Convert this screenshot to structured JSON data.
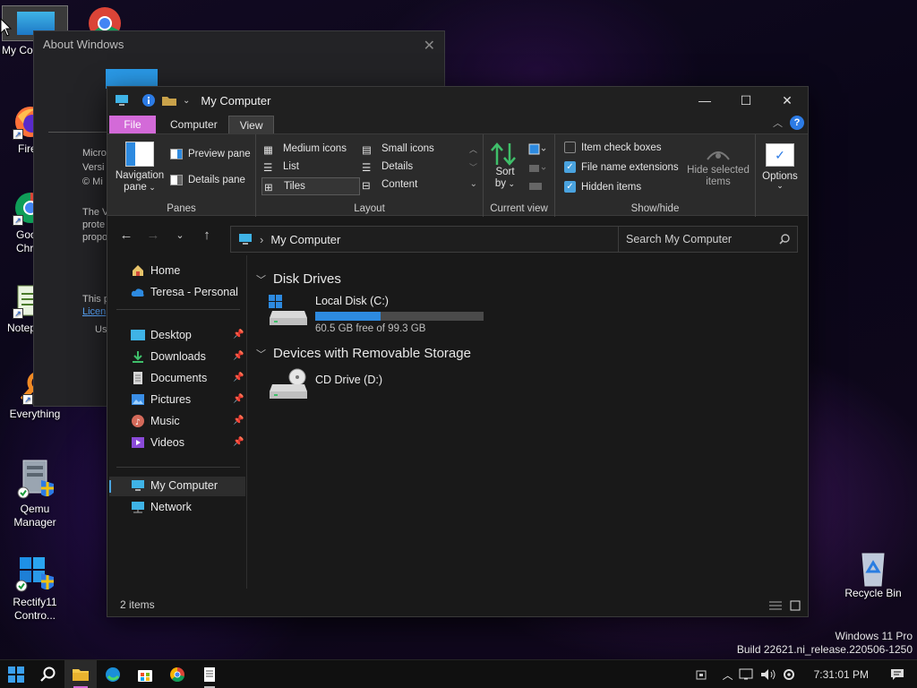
{
  "desktop": {
    "icons": [
      {
        "label": "My Co"
      },
      {
        "label": "Fire"
      },
      {
        "label": "Goo\nChro"
      },
      {
        "label": "Notep"
      },
      {
        "label": "Everything"
      },
      {
        "label": "Qemu\nManager"
      },
      {
        "label": "Rectify11\nContro..."
      },
      {
        "label": "Recycle Bin"
      }
    ],
    "watermark_line1": "Windows 11 Pro",
    "watermark_line2": "Build 22621.ni_release.220506-1250"
  },
  "about_window": {
    "title": "About Windows",
    "text_lines": [
      "Micro",
      "Versi",
      "© Mi",
      "The V",
      "prote",
      "propo",
      "This p",
      "Licen",
      "Us"
    ]
  },
  "explorer": {
    "title": "My Computer",
    "tabs": [
      {
        "label": "File"
      },
      {
        "label": "Computer"
      },
      {
        "label": "View"
      }
    ],
    "ribbon": {
      "panes": {
        "nav_pane_line1": "Navigation",
        "nav_pane_line2": "pane",
        "preview_pane": "Preview pane",
        "details_pane": "Details pane",
        "group_label": "Panes"
      },
      "layout": {
        "items": [
          "Medium icons",
          "Small icons",
          "List",
          "Details",
          "Tiles",
          "Content"
        ],
        "group_label": "Layout"
      },
      "current_view": {
        "sort_line1": "Sort",
        "sort_line2": "by",
        "group_label": "Current view"
      },
      "show_hide": {
        "item_check_boxes": "Item check boxes",
        "file_name_extensions": "File name extensions",
        "hidden_items": "Hidden items",
        "hide_selected_line1": "Hide selected",
        "hide_selected_line2": "items",
        "group_label": "Show/hide",
        "item_check_boxes_checked": false,
        "file_name_extensions_checked": true,
        "hidden_items_checked": true
      },
      "options_label": "Options"
    },
    "address": {
      "path": "My Computer",
      "search_placeholder": "Search My Computer"
    },
    "nav_pane": {
      "home": "Home",
      "onedrive": "Teresa - Personal",
      "quick": [
        "Desktop",
        "Downloads",
        "Documents",
        "Pictures",
        "Music",
        "Videos"
      ],
      "my_computer": "My Computer",
      "network": "Network"
    },
    "content": {
      "section_disk": "Disk Drives",
      "local_disk_name": "Local Disk (C:)",
      "local_disk_free": "60.5 GB free of 99.3 GB",
      "local_disk_used_fraction": 0.39,
      "section_removable": "Devices with Removable Storage",
      "cd_drive_name": "CD Drive (D:)"
    },
    "status": {
      "item_count": "2 items"
    }
  },
  "taskbar": {
    "time": "7:31:01 PM"
  },
  "colors": {
    "accent": "#d36ad8",
    "progress": "#2d8ae0",
    "checkbox": "#4aa3df"
  }
}
